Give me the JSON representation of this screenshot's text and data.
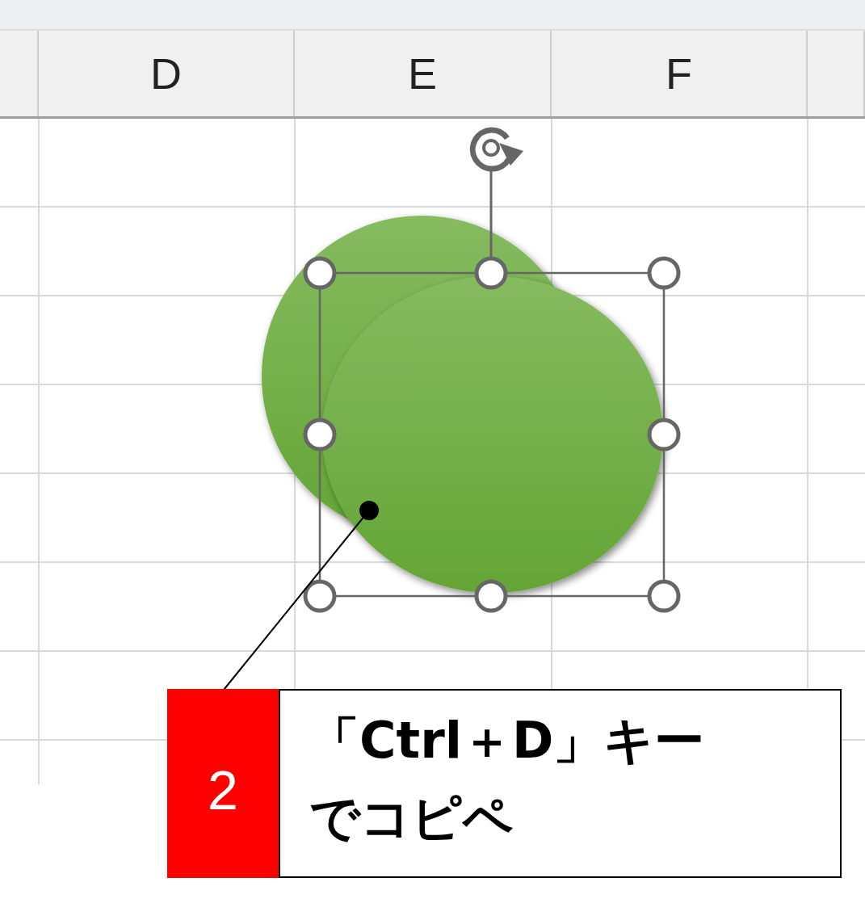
{
  "columns": [
    {
      "label": "D"
    },
    {
      "label": "E"
    },
    {
      "label": "F"
    }
  ],
  "shape": {
    "selected": true
  },
  "callout": {
    "number": "2",
    "lines": [
      "「Ctrl＋D」キー",
      "でコピペ"
    ]
  }
}
